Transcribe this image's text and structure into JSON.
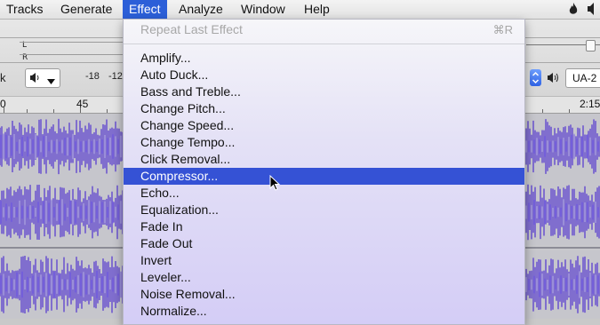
{
  "menubar": {
    "items": [
      {
        "label": "Tracks",
        "active": false
      },
      {
        "label": "Generate",
        "active": false
      },
      {
        "label": "Effect",
        "active": true
      },
      {
        "label": "Analyze",
        "active": false
      },
      {
        "label": "Window",
        "active": false
      },
      {
        "label": "Help",
        "active": false
      }
    ],
    "status_icons": [
      "flame-icon",
      "speaker-icon"
    ]
  },
  "toolbar": {
    "meter_channels": [
      "L",
      "R"
    ],
    "meter_db_labels": [
      "-18",
      "-12"
    ],
    "left_edge_label": "k",
    "device_value": "UA-2"
  },
  "timeline": {
    "labels": [
      "0",
      "45",
      "2:15"
    ]
  },
  "effect_menu": {
    "repeat": {
      "label": "Repeat Last Effect",
      "shortcut": "⌘R",
      "enabled": false
    },
    "items": [
      "Amplify...",
      "Auto Duck...",
      "Bass and Treble...",
      "Change Pitch...",
      "Change Speed...",
      "Change Tempo...",
      "Click Removal...",
      "Compressor...",
      "Echo...",
      "Equalization...",
      "Fade In",
      "Fade Out",
      "Invert",
      "Leveler...",
      "Noise Removal...",
      "Normalize..."
    ],
    "highlighted": "Compressor..."
  },
  "colors": {
    "menu_highlight": "#3552d5",
    "menubar_active": "#2c5fd8",
    "waveform": "#5a3fd0",
    "waveform_light": "#8f7fe4"
  }
}
